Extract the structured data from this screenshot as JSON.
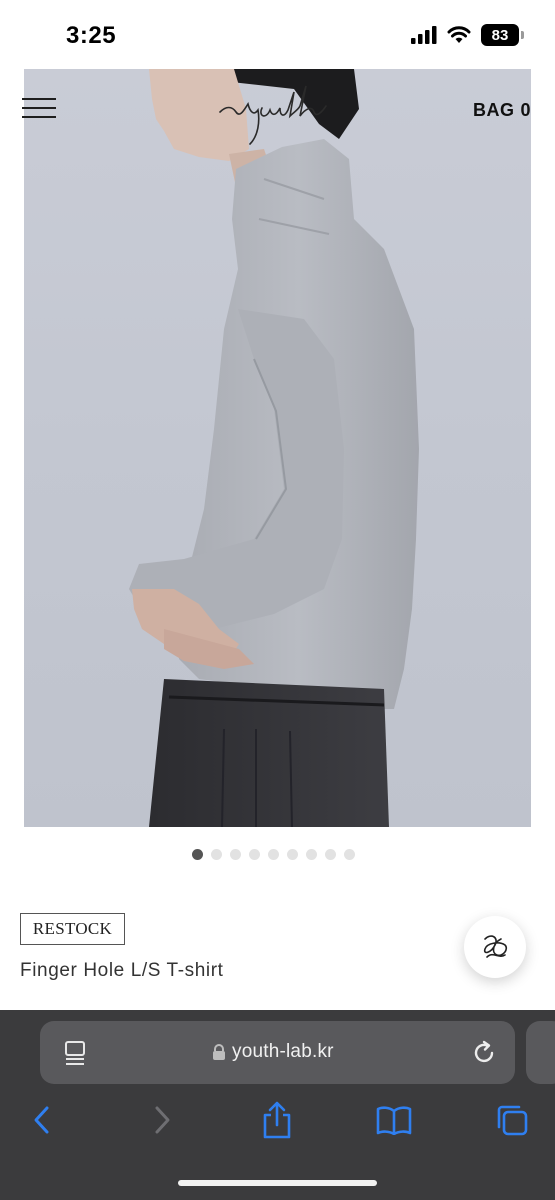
{
  "status_bar": {
    "time": "3:25",
    "battery": "83"
  },
  "header": {
    "bag_label": "BAG",
    "bag_count": "0"
  },
  "carousel": {
    "dot_count": 9,
    "active_index": 0
  },
  "product": {
    "badge": "RESTOCK",
    "name": "Finger Hole L/S T-shirt"
  },
  "browser": {
    "url": "youth-lab.kr"
  },
  "icons": {
    "menu": "hamburger-icon",
    "chat": "chat-logo-icon",
    "tabs_overview": "tab-overview-icon",
    "lock": "lock-icon",
    "reload": "reload-icon",
    "back": "chevron-left-icon",
    "forward": "chevron-right-icon",
    "share": "share-icon",
    "bookmarks": "book-icon",
    "tabs": "tabs-icon"
  },
  "colors": {
    "safari_blue": "#2f7ff0",
    "browser_bg": "#3b3b3d",
    "url_field_bg": "#59595c"
  }
}
